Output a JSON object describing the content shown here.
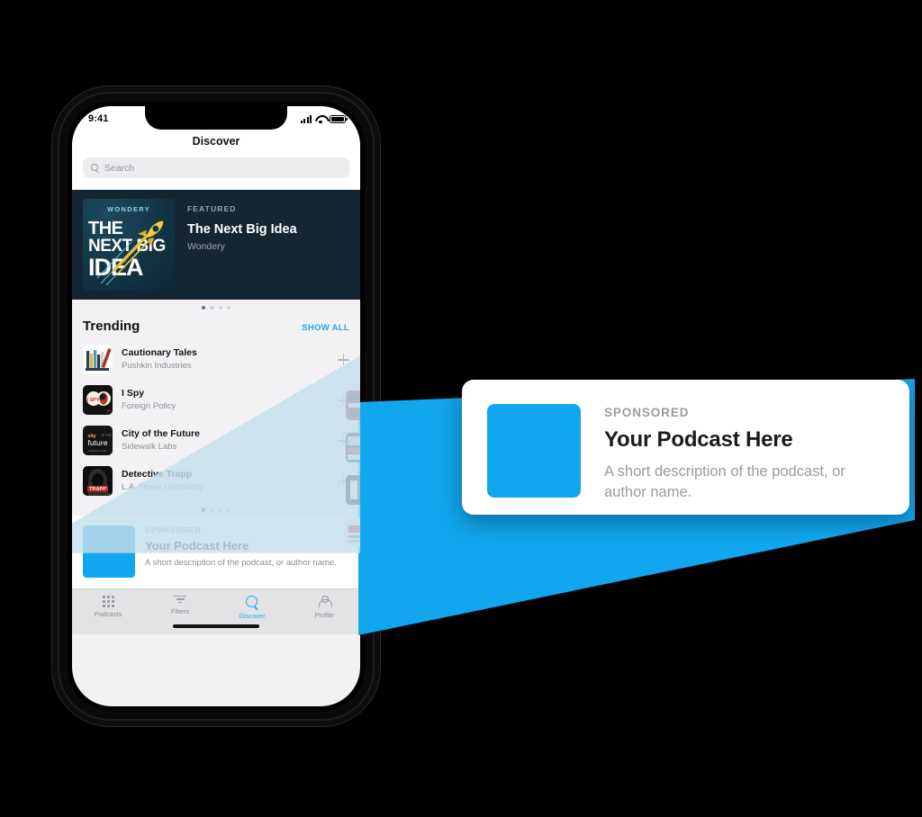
{
  "colors": {
    "accent_blue": "#12A6EE",
    "link_blue": "#22A7F0",
    "hero_bg": "#152633",
    "screen_bg": "#F2F2F4",
    "card_white": "#FFFFFF",
    "page_bg": "#000000",
    "beam_overlay": "rgba(195, 222, 236, 0.78)"
  },
  "phone": {
    "status_bar": {
      "time": "9:41",
      "icons": [
        "cellular-signal-icon",
        "wifi-icon",
        "battery-icon"
      ]
    },
    "nav": {
      "title": "Discover"
    },
    "search": {
      "placeholder": "Search",
      "value": "",
      "icon": "search-icon"
    },
    "hero": {
      "kicker": "FEATURED",
      "title": "The Next Big Idea",
      "subtitle": "Wondery",
      "artwork": {
        "network": "WONDERY",
        "line1": "THE",
        "line2": "NEXT BIG",
        "line3": "IDEA",
        "icon": "rocket-icon"
      }
    },
    "hero_pager": {
      "count": 4,
      "active_index": 0
    },
    "trending": {
      "title": "Trending",
      "show_all_label": "SHOW ALL",
      "items": [
        {
          "name": "Cautionary Tales",
          "author": "Pushkin Industries",
          "add_label": "+"
        },
        {
          "name": "I Spy",
          "author": "Foreign Policy",
          "add_label": "+"
        },
        {
          "name": "City of the Future",
          "author": "Sidewalk Labs",
          "add_label": "+"
        },
        {
          "name": "Detective Trapp",
          "author": "L.A. Times | Wondery",
          "add_label": "+"
        }
      ]
    },
    "trending_pager": {
      "count": 4,
      "active_index": 0
    },
    "sponsored": {
      "kicker": "SPONSORED",
      "title": "Your Podcast Here",
      "description": "A short description of the podcast, or author name."
    },
    "tabbar": {
      "items": [
        {
          "label": "Podcasts",
          "icon": "grid-icon",
          "active": false
        },
        {
          "label": "Filters",
          "icon": "filter-icon",
          "active": false
        },
        {
          "label": "Discover",
          "icon": "search-icon",
          "active": true
        },
        {
          "label": "Profile",
          "icon": "person-icon",
          "active": false
        }
      ]
    }
  },
  "callout": {
    "kicker": "SPONSORED",
    "title": "Your Podcast Here",
    "description": "A short description of the podcast, or author name.",
    "artwork_color": "#12A6EE"
  }
}
